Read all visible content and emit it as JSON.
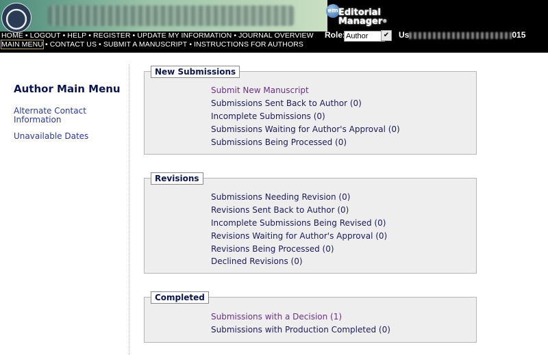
{
  "header": {
    "em_badge": "em",
    "em_title_line1": "Editorial",
    "em_title_line2": "Manager",
    "em_reg": "®",
    "nav_row1": [
      "HOME",
      "LOGOUT",
      "HELP",
      "REGISTER",
      "UPDATE MY INFORMATION",
      "JOURNAL OVERVIEW"
    ],
    "nav_row2": [
      "MAIN MENU",
      "CONTACT US",
      "SUBMIT A MANUSCRIPT",
      "INSTRUCTIONS FOR AUTHORS"
    ],
    "separator": "•",
    "role_label": "Role:",
    "role_value": "Author",
    "username_label": "Us",
    "username_suffix": "015"
  },
  "sidebar": {
    "title": "Author Main Menu",
    "links": [
      "Alternate Contact Information",
      "Unavailable Dates"
    ]
  },
  "sections": {
    "new_submissions": {
      "title": "New Submissions",
      "items": [
        "Submit New Manuscript",
        "Submissions Sent Back to Author (0)",
        "Incomplete Submissions (0)",
        "Submissions Waiting for Author's Approval (0)",
        "Submissions Being Processed (0)"
      ]
    },
    "revisions": {
      "title": "Revisions",
      "items": [
        "Submissions Needing Revision (0)",
        "Revisions Sent Back to Author (0)",
        "Incomplete Submissions Being Revised (0)",
        "Revisions Waiting for Author's Approval (0)",
        "Revisions Being Processed  (0)",
        "Declined Revisions (0)"
      ]
    },
    "completed": {
      "title": "Completed",
      "items": [
        "Submissions with a Decision (1)",
        "Submissions with Production Completed (0)"
      ]
    }
  },
  "colors": {
    "header_bg": "#000000",
    "active_link": "#6b2f87",
    "text": "#1a1a5e",
    "section_bg": "#eeeeee"
  }
}
